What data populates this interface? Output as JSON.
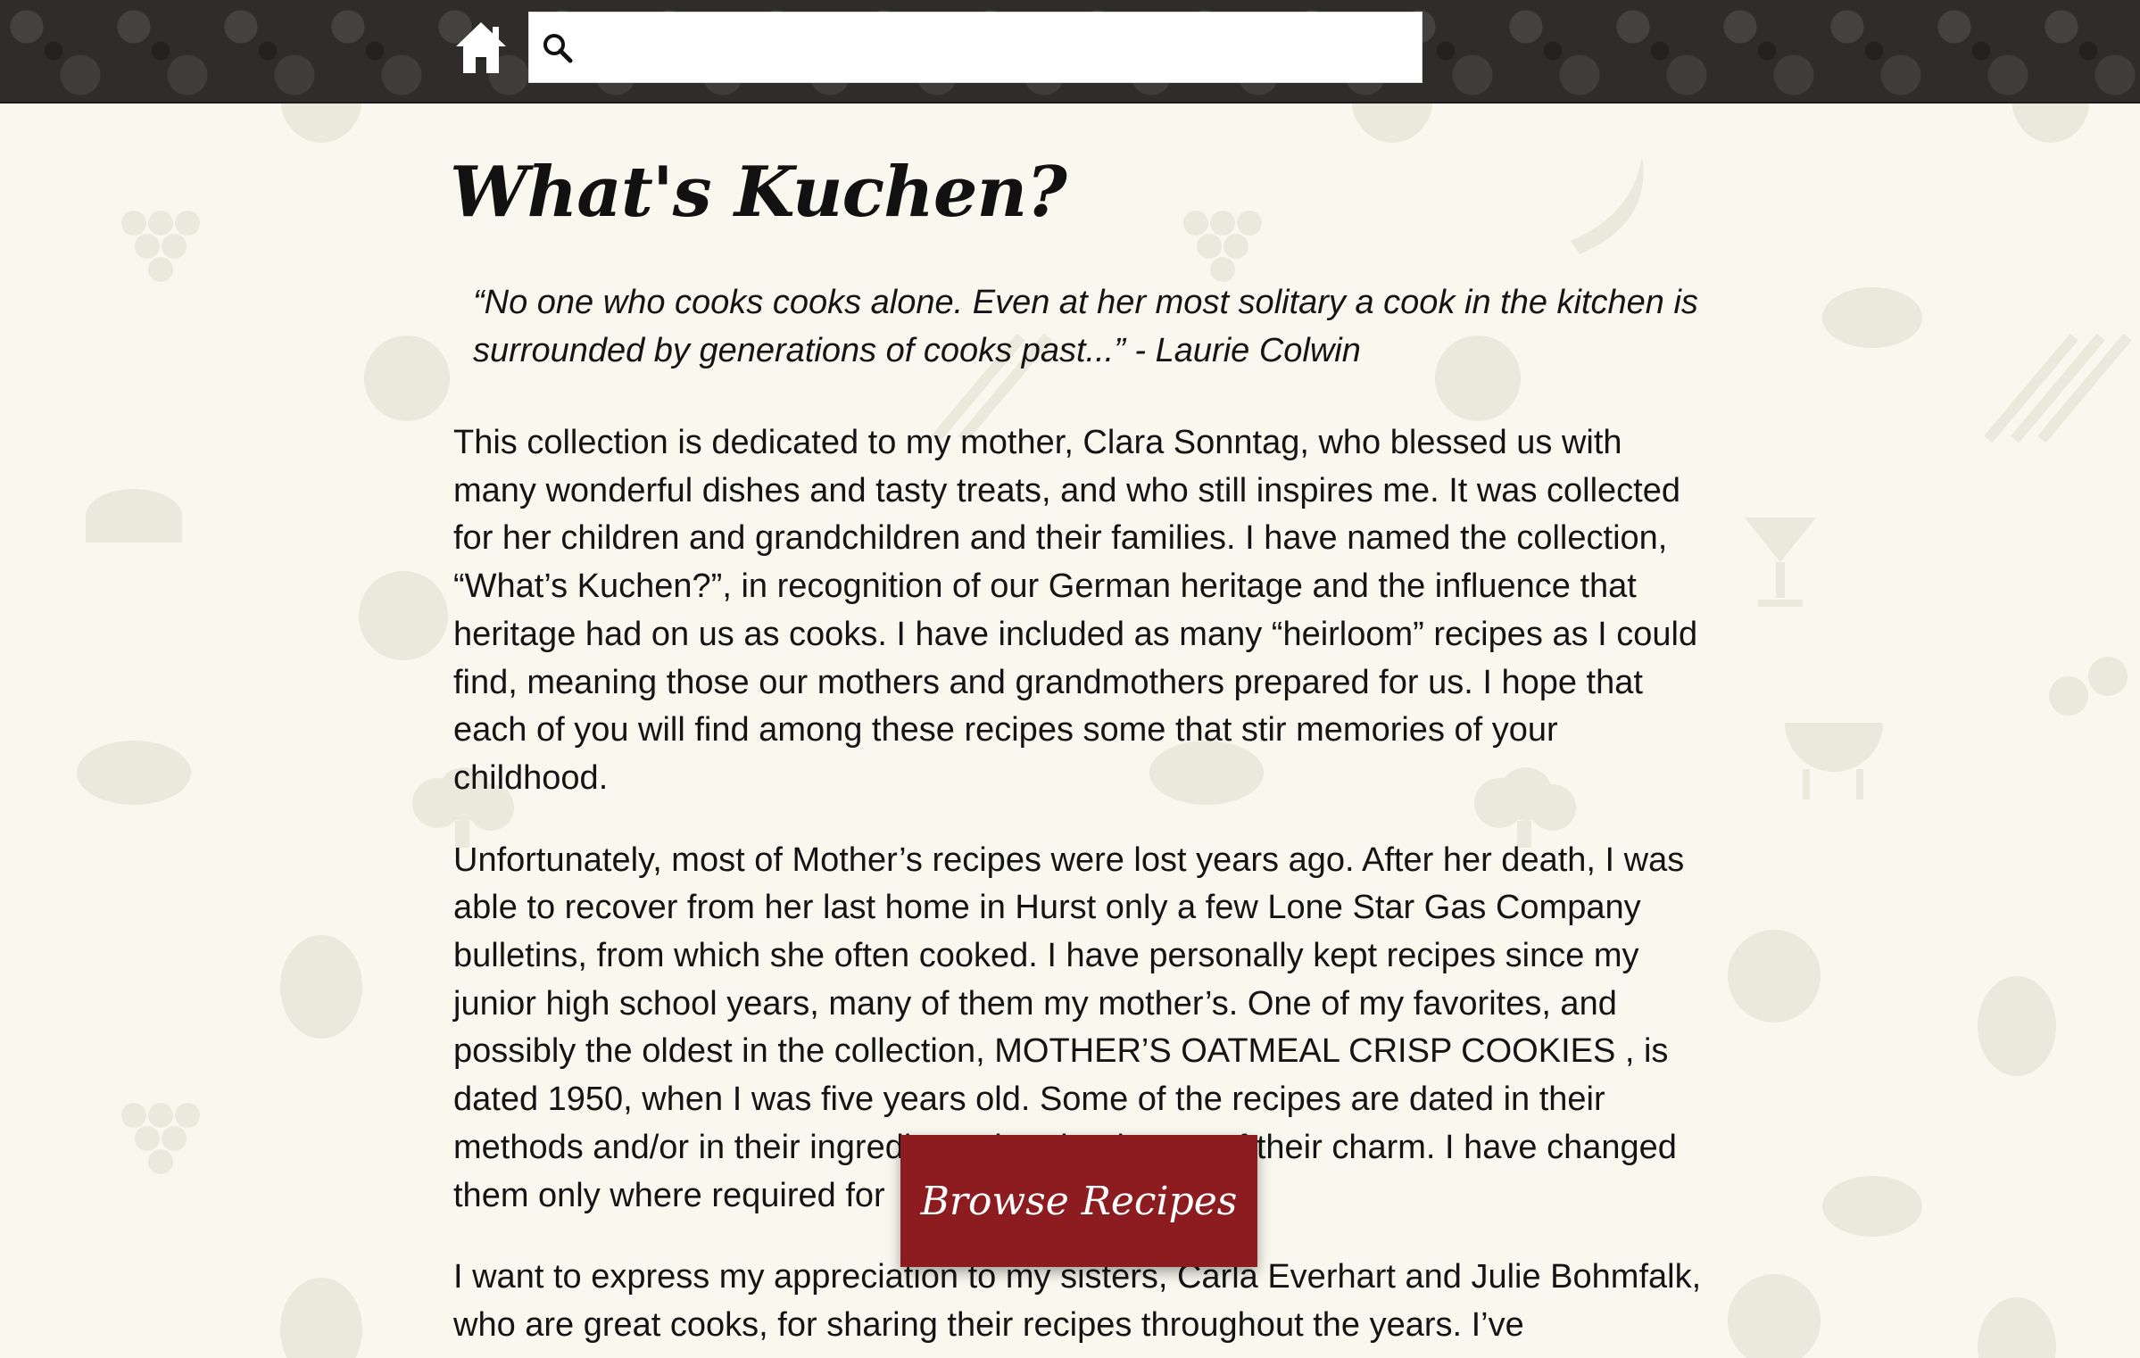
{
  "header": {
    "home_icon": "home-icon",
    "search_icon": "search-icon",
    "search_placeholder": "",
    "search_value": ""
  },
  "page": {
    "title": "What's Kuchen?",
    "quote": "“No one who cooks cooks alone. Even at her most solitary a cook in the kitchen is surrounded by generations of cooks past...” - Laurie Colwin",
    "paragraphs": [
      "This collection is dedicated to my mother, Clara Sonntag, who blessed us with many wonderful dishes and tasty treats, and who still inspires me. It was collected for her children and grandchildren and their families. I have named the collection, “What’s Kuchen?”, in recognition of our German heritage and the influence that heritage had on us as cooks. I have included as many “heirloom” recipes as I could find, meaning those our mothers and grandmothers prepared for us. I hope that each of you will find among these recipes some that stir memories of your childhood.",
      "Unfortunately, most of Mother’s recipes were lost years ago. After her death, I was able to recover from her last home in Hurst only a few Lone Star Gas Company bulletins, from which she often cooked. I have personally kept recipes since my junior high school years, many of them my mother’s. One of my favorites, and possibly the oldest in the collection, MOTHER’S OATMEAL CRISP COOKIES , is dated 1950, when I was five years old. Some of the recipes are dated in their methods and/or in their ingredients, but that is part of their charm. I have changed them only where required for",
      "I want to express my appreciation to my sisters, Carla Everhart and Julie Bohmfalk, who are great cooks, for sharing their recipes throughout the years. I’ve"
    ]
  },
  "browse_button": {
    "label": "Browse Recipes"
  },
  "colors": {
    "header_bg": "#2f2d2b",
    "page_bg": "#f8f8ee",
    "button_bg": "#8c1c1f",
    "text": "#141414"
  }
}
